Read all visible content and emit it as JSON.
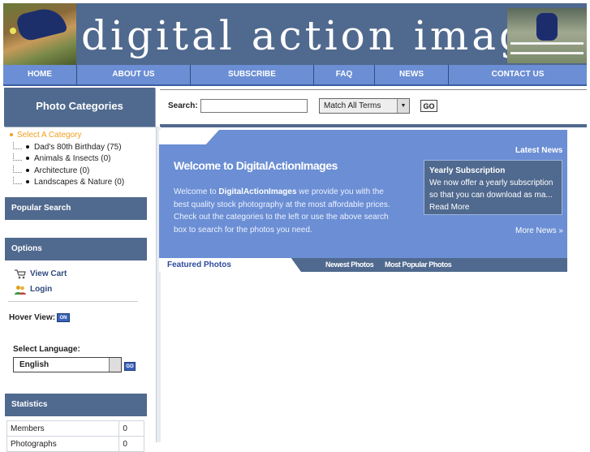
{
  "header": {
    "site_title": "digital action images"
  },
  "nav": [
    {
      "label": "HOME"
    },
    {
      "label": "ABOUT US"
    },
    {
      "label": "SUBSCRIBE"
    },
    {
      "label": "FAQ"
    },
    {
      "label": "NEWS"
    },
    {
      "label": "CONTACT US"
    }
  ],
  "categories": {
    "title": "Photo Categories",
    "root": "Select A Category",
    "items": [
      "Dad's 80th Birthday (75)",
      "Animals & Insects (0)",
      "Architecture (0)",
      "Landscapes & Nature (0)"
    ]
  },
  "search": {
    "label": "Search:",
    "value": "",
    "match_option": "Match All Terms",
    "go_label": "GO"
  },
  "sidebar": {
    "popular_search_title": "Popular Search",
    "options_title": "Options",
    "options": {
      "view_cart": "View Cart",
      "login": "Login"
    },
    "hover_view_label": "Hover View:",
    "hover_view_state": "ON",
    "language_label": "Select Language:",
    "language_value": "English",
    "language_go": "GO",
    "statistics_title": "Statistics",
    "stats": [
      {
        "label": "Members",
        "value": "0"
      },
      {
        "label": "Photographs",
        "value": "0"
      }
    ]
  },
  "welcome": {
    "title": "Welcome to DigitalActionImages",
    "text_prefix": "Welcome to ",
    "text_brand": "DigitalActionImages",
    "text_rest": " we provide you with the best quality stock photography at the most affordable prices. Check out the categories to the left or use the above search box to search for the photos you need."
  },
  "news": {
    "section_label": "Latest News",
    "item_title": "Yearly Subscription",
    "item_text": "We now offer a yearly subscription so that you can download as ma...",
    "read_more": "Read More",
    "more_news": "More News »"
  },
  "tabs": {
    "featured": "Featured Photos",
    "newest": "Newest Photos",
    "popular": "Most Popular Photos"
  }
}
